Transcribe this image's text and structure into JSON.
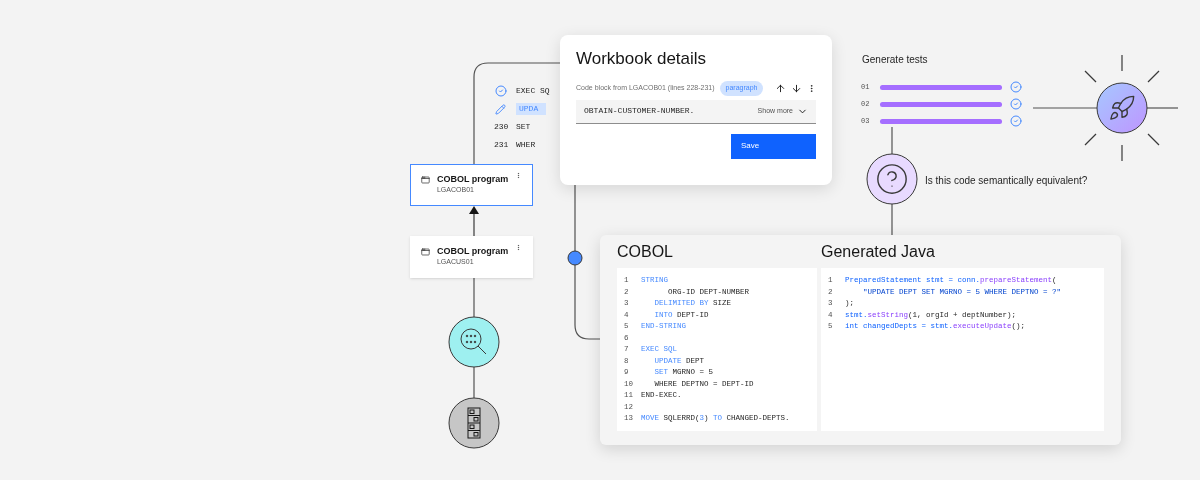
{
  "flow": {
    "nodes": [
      {
        "title": "COBOL program",
        "subtitle": "LGACOB01",
        "selected": true
      },
      {
        "title": "COBOL program",
        "subtitle": "LGACUS01",
        "selected": false
      }
    ]
  },
  "code_snippet": {
    "lines": [
      {
        "kind": "verified",
        "text": "EXEC SQ",
        "highlighted": false
      },
      {
        "kind": "edited",
        "text": "UPDA",
        "highlighted": true
      },
      {
        "kind": "numbered",
        "number": "230",
        "text": "SET",
        "highlighted": false
      },
      {
        "kind": "numbered",
        "number": "231",
        "text": "WHER",
        "highlighted": false
      }
    ]
  },
  "workbook": {
    "title": "Workbook details",
    "source": "Code block from LGACOB01 (lines 228-231)",
    "tag": "paragraph",
    "field_value": "OBTAIN-CUSTOMER-NUMBER.",
    "show_more": "Show more",
    "save": "Save"
  },
  "comparison": {
    "panels": [
      {
        "title": "COBOL",
        "lines": [
          {
            "number": "1",
            "segments": [
              {
                "kind": "keyword",
                "text": "STRING"
              }
            ]
          },
          {
            "number": "2",
            "segments": [
              {
                "kind": "plain",
                "text": "      ORG-ID DEPT-NUMBER"
              }
            ]
          },
          {
            "number": "3",
            "segments": [
              {
                "kind": "keyword",
                "text": "   DELIMITED BY"
              },
              {
                "kind": "plain",
                "text": " SIZE"
              }
            ]
          },
          {
            "number": "4",
            "segments": [
              {
                "kind": "keyword",
                "text": "   INTO"
              },
              {
                "kind": "plain",
                "text": " DEPT-ID"
              }
            ]
          },
          {
            "number": "5",
            "segments": [
              {
                "kind": "keyword",
                "text": "END-STRING"
              }
            ]
          },
          {
            "number": "6"
          },
          {
            "number": "7",
            "segments": [
              {
                "kind": "keyword",
                "text": "EXEC SQL"
              }
            ]
          },
          {
            "number": "8",
            "segments": [
              {
                "kind": "keyword",
                "text": "   UPDATE"
              },
              {
                "kind": "plain",
                "text": " DEPT"
              }
            ]
          },
          {
            "number": "9",
            "segments": [
              {
                "kind": "keyword",
                "text": "   SET"
              },
              {
                "kind": "plain",
                "text": " MGRNO = 5"
              }
            ]
          },
          {
            "number": "10",
            "segments": [
              {
                "kind": "plain",
                "text": "   WHERE DEPTNO = DEPT-ID"
              }
            ]
          },
          {
            "number": "11",
            "segments": [
              {
                "kind": "plain",
                "text": "END-EXEC."
              }
            ]
          },
          {
            "number": "12"
          },
          {
            "number": "13",
            "segments": [
              {
                "kind": "keyword",
                "text": "MOVE"
              },
              {
                "kind": "plain",
                "text": " SQLERRD("
              },
              {
                "kind": "keyword",
                "text": "3"
              },
              {
                "kind": "plain",
                "text": ")"
              },
              {
                "kind": "keyword",
                "text": " TO"
              },
              {
                "kind": "plain",
                "text": " CHANGED-DEPTS."
              }
            ]
          }
        ]
      },
      {
        "title": "Generated Java",
        "lines": [
          {
            "number": "1",
            "segments": [
              {
                "kind": "type",
                "text": "PreparedStatement stmt = conn."
              },
              {
                "kind": "method",
                "text": "prepareStatement"
              },
              {
                "kind": "plain",
                "text": "("
              }
            ]
          },
          {
            "number": "2",
            "segments": [
              {
                "kind": "string",
                "text": "    \"UPDATE DEPT SET MGRNO = 5 WHERE DEPTNO = ?\""
              }
            ]
          },
          {
            "number": "3",
            "segments": [
              {
                "kind": "plain",
                "text": ");"
              }
            ]
          },
          {
            "number": "4",
            "segments": [
              {
                "kind": "type",
                "text": "stmt."
              },
              {
                "kind": "method",
                "text": "setString"
              },
              {
                "kind": "plain",
                "text": "(1, orgId + deptNumber);"
              }
            ]
          },
          {
            "number": "5",
            "segments": [
              {
                "kind": "type",
                "text": "int changedDepts = stmt."
              },
              {
                "kind": "method",
                "text": "executeUpdate"
              },
              {
                "kind": "plain",
                "text": "();"
              }
            ]
          }
        ]
      }
    ]
  },
  "tests": {
    "title": "Generate tests",
    "items": [
      {
        "number": "01",
        "level": 1,
        "passed": true
      },
      {
        "number": "02",
        "level": 1,
        "passed": true
      },
      {
        "number": "03",
        "level": 1,
        "passed": true
      }
    ]
  },
  "question": "Is this code semantically equivalent?"
}
